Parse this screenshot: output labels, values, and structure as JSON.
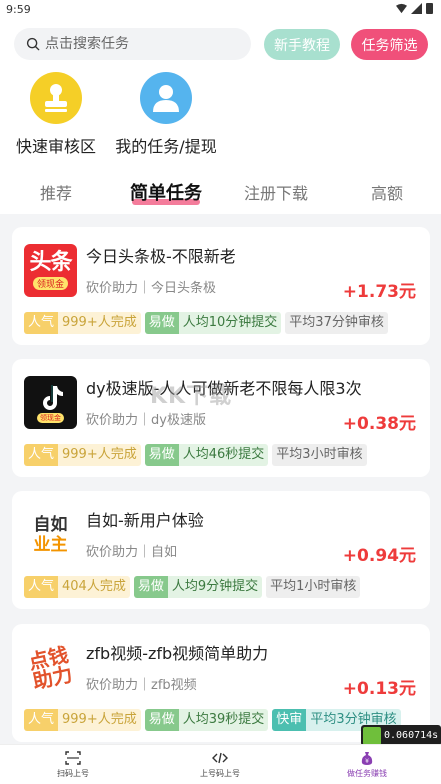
{
  "status": {
    "time": "9:59"
  },
  "search": {
    "placeholder": "点击搜索任务"
  },
  "header_buttons": {
    "tutorial": "新手教程",
    "filter": "任务筛选"
  },
  "shortcuts": [
    {
      "label": "快速审核区",
      "icon": "stamp-icon",
      "color": "#f5cf27"
    },
    {
      "label": "我的任务/提现",
      "icon": "user-icon",
      "color": "#55b4ee"
    }
  ],
  "tabs": [
    {
      "label": "推荐"
    },
    {
      "label": "简单任务",
      "active": true
    },
    {
      "label": "注册下载"
    },
    {
      "label": "高额"
    }
  ],
  "tasks": [
    {
      "title": "今日头条极-不限新老",
      "icon_text": "头条",
      "icon_badge": "领现金",
      "subtitle": "砍价助力｜今日头条极",
      "price": "+1.73元",
      "tags": [
        {
          "key": "人气",
          "value": "999+人完成"
        },
        {
          "key": "易做",
          "value": "人均10分钟提交"
        },
        {
          "value": "平均37分钟审核"
        }
      ]
    },
    {
      "title": "dy极速版-人人可做新老不限每人限3次",
      "icon_badge": "领现金",
      "subtitle": "砍价助力｜dy极速版",
      "price": "+0.38元",
      "tags": [
        {
          "key": "人气",
          "value": "999+人完成"
        },
        {
          "key": "易做",
          "value": "人均46秒提交"
        },
        {
          "value": "平均3小时审核"
        }
      ]
    },
    {
      "title": "自如-新用户体验",
      "icon_text": "自如",
      "icon_text2": "业主",
      "subtitle": "砍价助力｜自如",
      "price": "+0.94元",
      "tags": [
        {
          "key": "人气",
          "value": "404人完成"
        },
        {
          "key": "易做",
          "value": "人均9分钟提交"
        },
        {
          "value": "平均1小时审核"
        }
      ]
    },
    {
      "title": "zfb视频-zfb视频简单助力",
      "icon_text": "点钱助力",
      "subtitle": "砍价助力｜zfb视频",
      "price": "+0.13元",
      "tags": [
        {
          "key": "人气",
          "value": "999+人完成"
        },
        {
          "key": "易做",
          "value": "人均39秒提交"
        },
        {
          "key": "快审",
          "value": "平均3分钟审核"
        }
      ]
    }
  ],
  "watermark": "KK下载",
  "bottom_nav": [
    {
      "label": "扫码上号",
      "icon": "scan-icon"
    },
    {
      "label": "上号码上号",
      "icon": "code-icon"
    },
    {
      "label": "做任务赚钱",
      "icon": "money-bag-icon"
    }
  ],
  "overlay_timer": "0.060714s",
  "colors": {
    "accent_pink": "#f0507a",
    "price_red": "#ee3b3b",
    "mint": "#a8e0cf"
  }
}
